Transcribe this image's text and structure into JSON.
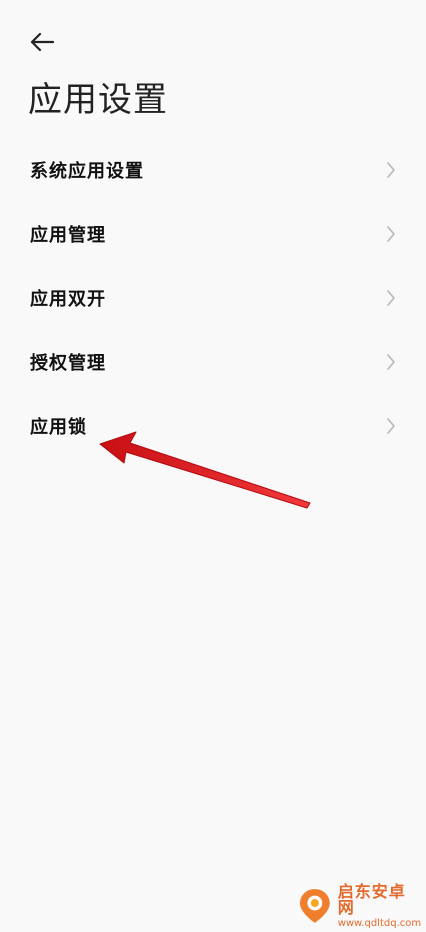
{
  "header": {
    "back_icon": "arrow-left-icon",
    "title": "应用设置"
  },
  "menu": {
    "chevron_icon": "chevron-right-icon",
    "items": [
      {
        "label": "系统应用设置"
      },
      {
        "label": "应用管理"
      },
      {
        "label": "应用双开"
      },
      {
        "label": "授权管理"
      },
      {
        "label": "应用锁"
      }
    ]
  },
  "annotation": {
    "arrow_color": "#e8151b"
  },
  "watermark": {
    "title": "启东安卓网",
    "url": "www.qdltdq.com",
    "color": "#e26a2c"
  },
  "colors": {
    "background": "#f9f9f9",
    "text_primary": "#111111",
    "chevron": "#b8b8b8"
  }
}
